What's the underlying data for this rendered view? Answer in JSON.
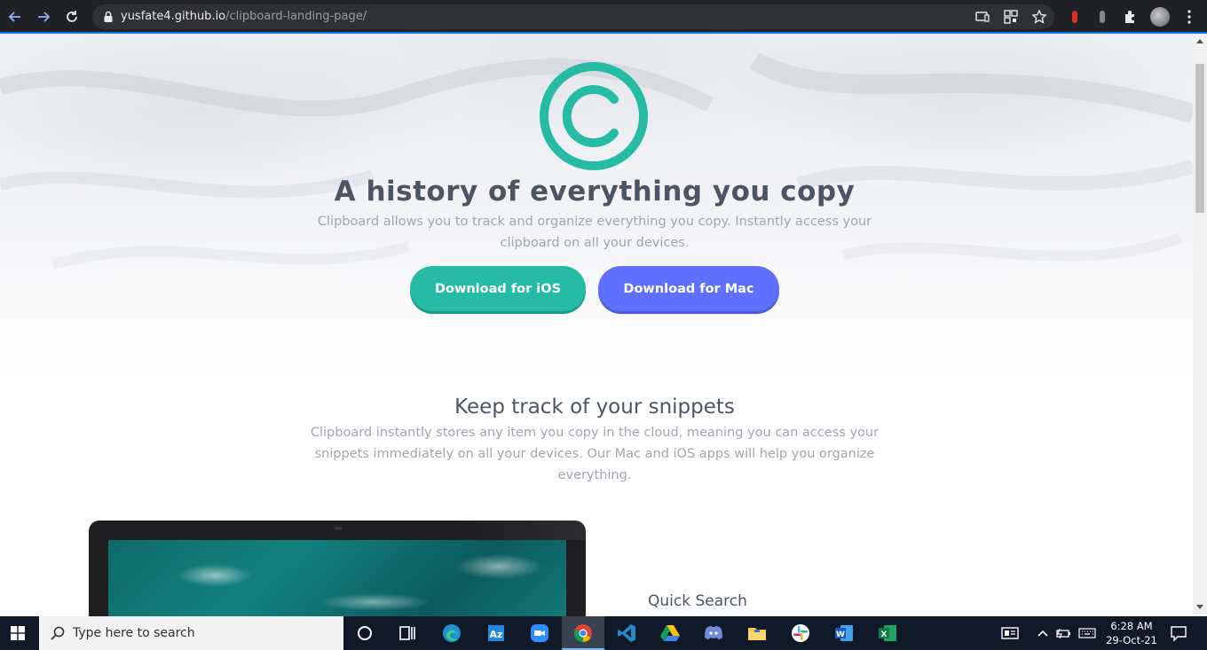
{
  "browser": {
    "url_host": "yusfate4.github.io",
    "url_path": "/clipboard-landing-page/"
  },
  "hero": {
    "title": "A history of everything you copy",
    "description": "Clipboard allows you to track and organize everything you copy. Instantly access your clipboard on all your devices.",
    "ios_button": "Download for iOS",
    "mac_button": "Download for Mac",
    "logo_icon": "copyright-logo-icon"
  },
  "snippets": {
    "title": "Keep track of your snippets",
    "description": "Clipboard instantly stores any item you copy in the cloud, meaning you can access your snippets immediately on all your devices. Our Mac and iOS apps will help you organize everything."
  },
  "features": {
    "first_title": "Quick Search"
  },
  "colors": {
    "accent_teal": "#26bba5",
    "accent_blue": "#6070fe",
    "heading": "#4c5564",
    "body_text": "#a0a6b1"
  },
  "taskbar": {
    "search_placeholder": "Type here to search",
    "time": "6:28 AM",
    "date": "29-Oct-21",
    "apps": [
      "task-view",
      "edge",
      "azure",
      "zoom",
      "chrome",
      "vscode",
      "google-drive",
      "discord",
      "file-explorer",
      "slack",
      "word",
      "excel"
    ]
  }
}
